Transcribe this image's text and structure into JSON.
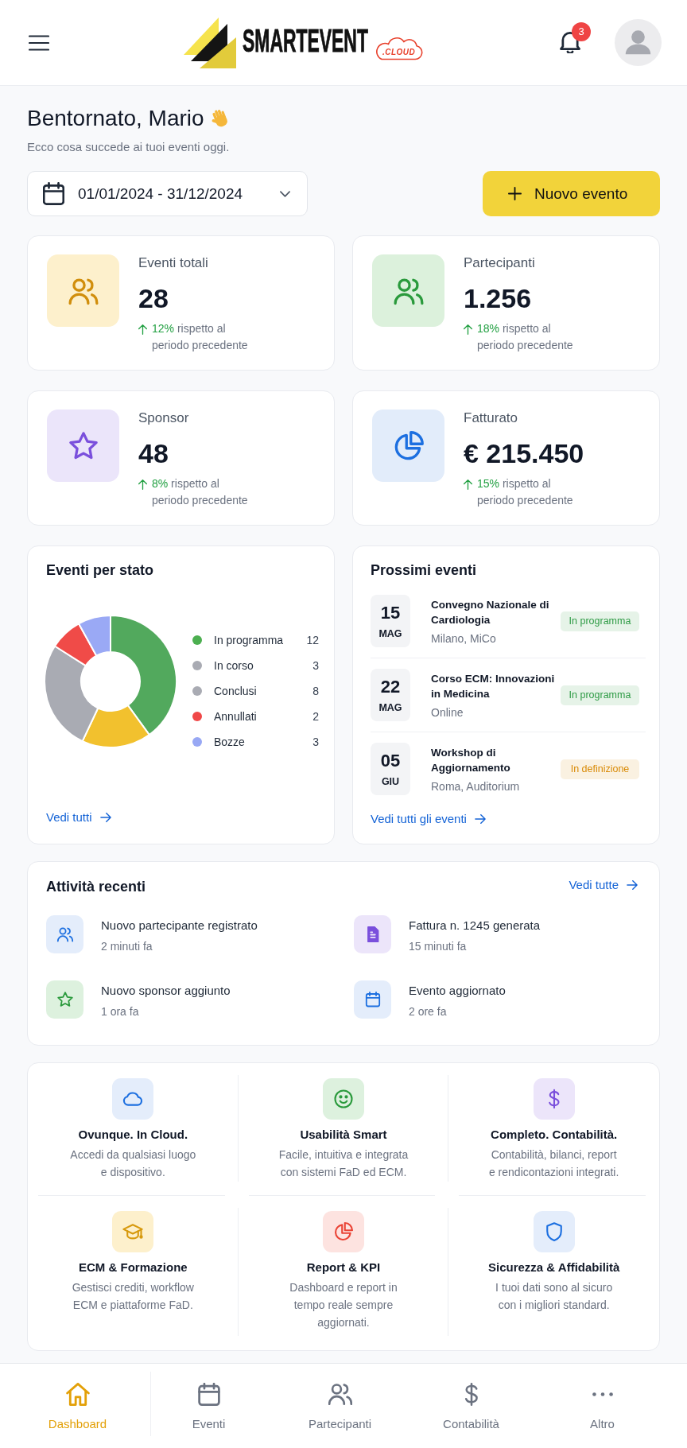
{
  "top_bar": {
    "notification_count": "3"
  },
  "logo": {
    "name": "SMARTEVENT",
    "suffix": ".CLOUD"
  },
  "greeting": {
    "title": "Bentornato, Mario",
    "subtitle": "Ecco cosa succede ai tuoi eventi oggi."
  },
  "date_range": {
    "value": "01/01/2024 - 31/12/2024"
  },
  "new_event_button": {
    "label": "Nuovo evento"
  },
  "stats": [
    {
      "label": "Eventi totali",
      "value": "28",
      "change": "12%",
      "note": "rispetto al periodo precedente"
    },
    {
      "label": "Partecipanti",
      "value": "1.256",
      "change": "18%",
      "note": "rispetto al periodo precedente"
    },
    {
      "label": "Sponsor",
      "value": "48",
      "change": "8%",
      "note": "rispetto al periodo precedente"
    },
    {
      "label": "Fatturato",
      "value": "€ 215.450",
      "change": "15%",
      "note": "rispetto al periodo precedente"
    }
  ],
  "status_chart": {
    "title": "Eventi per stato",
    "chart_data": {
      "type": "donut",
      "categories": [
        "In programma",
        "In corso",
        "Conclusi",
        "Annullati",
        "Bozze"
      ],
      "values": [
        40,
        17,
        27,
        8,
        8
      ],
      "colors": [
        "#52a95d",
        "#f2c12e",
        "#a9abb3",
        "#f04b48",
        "#9aa9f5"
      ]
    },
    "legend": [
      {
        "count": "12",
        "color": "#4caf50"
      },
      {
        "count": "3",
        "color": "#a9abb3"
      },
      {
        "count": "8",
        "color": "#a9abb3"
      },
      {
        "count": "2",
        "color": "#f04848"
      },
      {
        "count": "3",
        "color": "#98a8f4"
      }
    ],
    "link": "Vedi tutti"
  },
  "upcoming_events": {
    "title": "Prossimi eventi",
    "events": [
      {
        "day": "15",
        "month": "MAG",
        "title": "Convegno Nazionale di Cardiologia",
        "location": "Milano, MiCo",
        "status": "In programma",
        "color": "#2e9b45"
      },
      {
        "day": "22",
        "month": "MAG",
        "title": "Corso ECM: Innovazioni in Medicina",
        "location": "Online",
        "status": "In programma",
        "color": "#2e9b45"
      },
      {
        "day": "05",
        "month": "GIU",
        "title": "Workshop di Aggiornamento",
        "location": "Roma, Auditorium",
        "status": "In definizione",
        "color": "#d98a06"
      }
    ],
    "link": "Vedi tutti gli eventi"
  },
  "recent_activity": {
    "title": "Attività recenti",
    "link": "Vedi tutte",
    "items": [
      {
        "title": "Nuovo partecipante registrato",
        "time": "2 minuti fa"
      },
      {
        "title": "Fattura n. 1245 generata",
        "time": "15 minuti fa"
      },
      {
        "title": "Nuovo sponsor aggiunto",
        "time": "1 ora fa"
      },
      {
        "title": "Evento aggiornato",
        "time": "2 ore fa"
      }
    ]
  },
  "features": [
    {
      "title": "Ovunque. In Cloud.",
      "description": "Accedi da qualsiasi luogo e dispositivo."
    },
    {
      "title": "Usabilità Smart",
      "description": "Facile, intuitiva e integrata con sistemi FaD ed ECM."
    },
    {
      "title": "Completo. Contabilità.",
      "description": "Contabilità, bilanci, report e rendicontazioni integrati."
    },
    {
      "title": "ECM & Formazione",
      "description": "Gestisci crediti, workflow ECM e piattaforme FaD."
    },
    {
      "title": "Report & KPI",
      "description": "Dashboard e report in tempo reale sempre aggiornati."
    },
    {
      "title": "Sicurezza & Affidabilità",
      "description": "I tuoi dati sono al sicuro con i migliori standard."
    }
  ],
  "bottom_nav": [
    {
      "label": "Dashboard",
      "selected": true
    },
    {
      "label": "Eventi",
      "selected": false
    },
    {
      "label": "Partecipanti",
      "selected": false
    },
    {
      "label": "Contabilità",
      "selected": false
    },
    {
      "label": "Altro",
      "selected": false
    }
  ]
}
